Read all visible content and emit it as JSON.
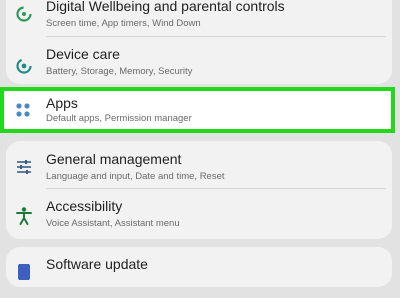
{
  "settings": {
    "wellbeing": {
      "title": "Digital Wellbeing and parental controls",
      "subtitle": "Screen time, App timers, Wind Down",
      "icon": "wellbeing-icon"
    },
    "device_care": {
      "title": "Device care",
      "subtitle": "Battery, Storage, Memory, Security",
      "icon": "device-care-icon"
    },
    "apps": {
      "title": "Apps",
      "subtitle": "Default apps, Permission manager",
      "icon": "apps-icon"
    },
    "general_management": {
      "title": "General management",
      "subtitle": "Language and input, Date and time, Reset",
      "icon": "sliders-icon"
    },
    "accessibility": {
      "title": "Accessibility",
      "subtitle": "Voice Assistant, Assistant menu",
      "icon": "accessibility-icon"
    },
    "software_update": {
      "title": "Software update",
      "icon": "software-update-icon"
    }
  },
  "colors": {
    "highlight_border": "#22d81b",
    "green_icon": "#2e9a5a",
    "teal_icon": "#1f8c8a",
    "blue_icon": "#4a88c9",
    "sliders_icon": "#3b5f86",
    "accessibility_icon": "#1f7a3a"
  }
}
